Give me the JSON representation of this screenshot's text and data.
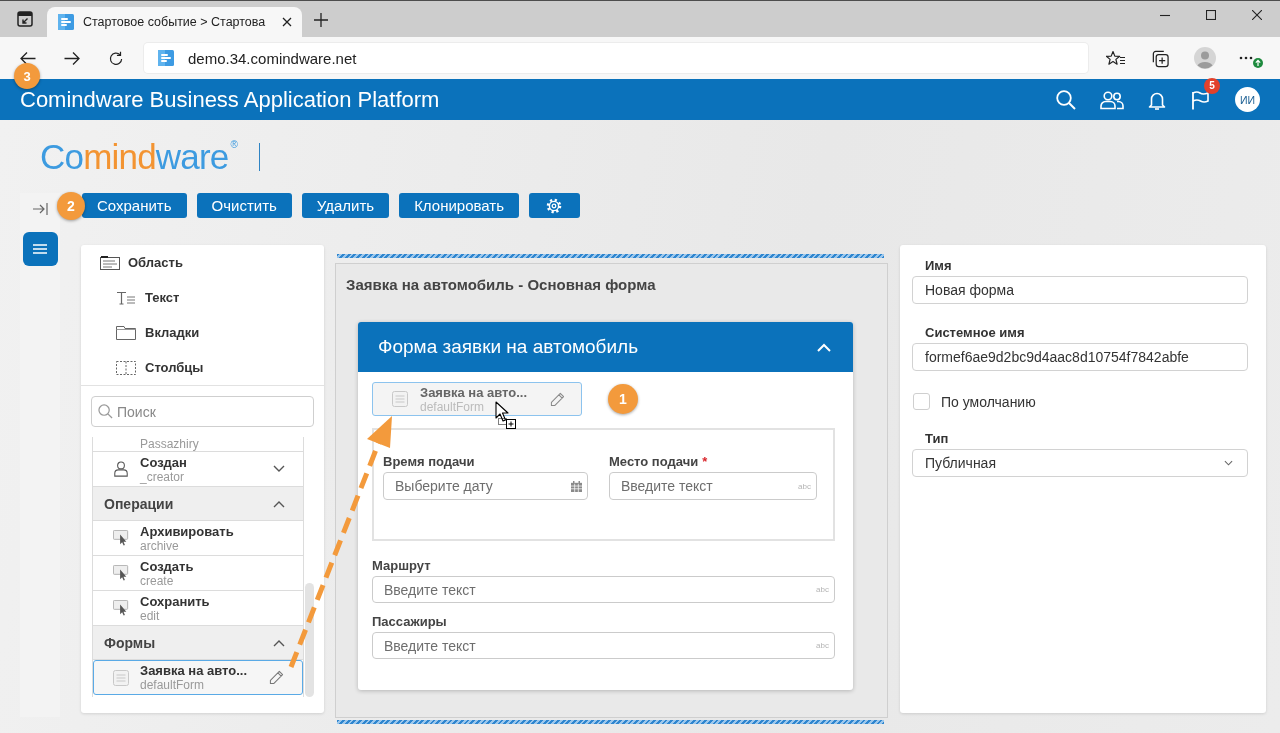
{
  "browser": {
    "tabs": [
      {
        "title": "Стартовое событие > Стартова",
        "selected": true
      }
    ],
    "address": "demo.34.comindware.net"
  },
  "app_header": {
    "title": "Comindware Business Application Platform",
    "callout": "3",
    "flag_badge": "5",
    "avatar": "ИИ"
  },
  "logo": {
    "parts": [
      {
        "text": "Co",
        "kind": "primary"
      },
      {
        "text": "mind",
        "kind": "accent"
      },
      {
        "text": "ware",
        "kind": "primary"
      }
    ],
    "trademark": "®"
  },
  "side_rail": {
    "items": [
      {
        "kind": "collapse",
        "selected": false
      },
      {
        "kind": "menu",
        "selected": true
      }
    ]
  },
  "toolbar": {
    "callout": "2",
    "buttons": [
      {
        "kind": "text",
        "label": "Сохранить"
      },
      {
        "kind": "text",
        "label": "Очистить"
      },
      {
        "kind": "text",
        "label": "Удалить"
      },
      {
        "kind": "text",
        "label": "Клонировать"
      },
      {
        "kind": "settings"
      }
    ]
  },
  "palette": {
    "layout_items": [
      {
        "kind": "area",
        "label": "Область",
        "children": [
          {
            "kind": "text",
            "label": "Текст"
          },
          {
            "kind": "tabs",
            "label": "Вкладки"
          },
          {
            "kind": "columns",
            "label": "Столбцы"
          }
        ]
      }
    ],
    "search": {
      "placeholder": "Поиск"
    },
    "list": [
      {
        "kind": "field",
        "system_name": "Passazhiry",
        "selected": false
      },
      {
        "kind": "person",
        "name": "Создан",
        "system_name": "_creator",
        "expanded": false,
        "selected": false
      },
      {
        "kind": "section",
        "title": "Операции",
        "expanded": true,
        "items": [
          {
            "kind": "operation",
            "name": "Архивировать",
            "system_name": "archive",
            "selected": false
          },
          {
            "kind": "operation",
            "name": "Создать",
            "system_name": "create",
            "selected": false
          },
          {
            "kind": "operation",
            "name": "Сохранить",
            "system_name": "edit",
            "selected": false
          }
        ]
      },
      {
        "kind": "section",
        "title": "Формы",
        "expanded": true,
        "items": [
          {
            "kind": "form",
            "name": "Заявка на авто...",
            "system_name": "defaultForm",
            "selected": true
          }
        ]
      }
    ]
  },
  "canvas": {
    "title": "Заявка на автомобиль - Основная форма",
    "form": {
      "title": "Форма заявки на автомобиль",
      "expanded": true,
      "callout": "1",
      "dragged_item": {
        "name": "Заявка на авто...",
        "system_name": "defaultForm"
      },
      "group_fields": [
        {
          "kind": "date",
          "label": "Время подачи",
          "placeholder": "Выберите дату"
        },
        {
          "kind": "text",
          "label": "Место подачи",
          "required_mark": "*",
          "placeholder": "Введите текст",
          "type_hint": "abc"
        }
      ],
      "fields": [
        {
          "kind": "text",
          "label": "Маршрут",
          "placeholder": "Введите текст",
          "type_hint": "abc"
        },
        {
          "kind": "text",
          "label": "Пассажиры",
          "placeholder": "Введите текст",
          "type_hint": "abc"
        }
      ]
    }
  },
  "properties": {
    "fields": [
      {
        "kind": "input",
        "label": "Имя",
        "value": "Новая форма"
      },
      {
        "kind": "input",
        "label": "Системное имя",
        "value": "formef6ae9d2bc9d4aac8d10754f7842abfe"
      },
      {
        "kind": "checkbox",
        "label": "По умолчанию",
        "checked": false
      },
      {
        "kind": "select",
        "label": "Тип",
        "value": "Публичная"
      }
    ]
  }
}
